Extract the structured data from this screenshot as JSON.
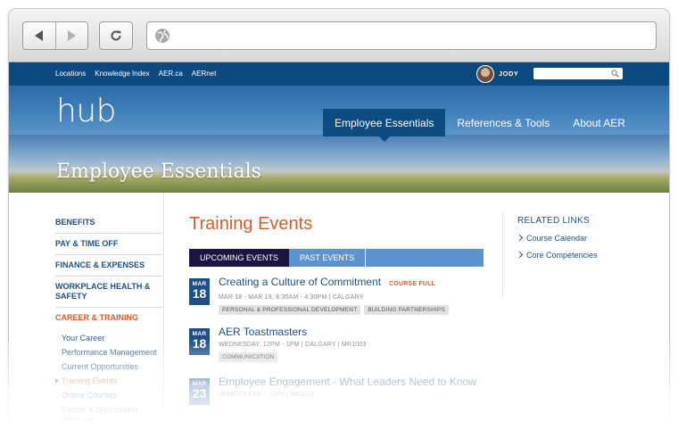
{
  "topbar": {
    "links": [
      "Locations",
      "Knowledge Index",
      "AER.ca",
      "AERnet"
    ],
    "username": "JODY",
    "search_placeholder": ""
  },
  "hero": {
    "logo": "hub",
    "nav": [
      "Employee Essentials",
      "References & Tools",
      "About AER"
    ],
    "active_nav": "Employee Essentials",
    "title": "Employee Essentials"
  },
  "sidebar": {
    "items": [
      "BENEFITS",
      "PAY & TIME OFF",
      "FINANCE & EXPENSES",
      "WORKPLACE HEALTH & SAFETY",
      "CAREER & TRAINING"
    ],
    "subitems": [
      "Your Career",
      "Performance Management",
      "Current Opportunities",
      "Training Events",
      "Online Courses",
      "Career & Succession Planning"
    ]
  },
  "main": {
    "title": "Training Events",
    "tabs": [
      "UPCOMING EVENTS",
      "PAST EVENTS"
    ],
    "events": [
      {
        "month": "MAR",
        "day": "18",
        "title": "Creating a Culture of Commitment",
        "badge": "COURSE FULL",
        "meta": "MAR 18 - MAR 19, 8:30AM - 4:30PM | CALGARY",
        "tags": [
          "PERSONAL & PROFESSIONAL DEVELOPMENT",
          "BUILDING PARTNERSHIPS"
        ]
      },
      {
        "month": "MAR",
        "day": "18",
        "title": "AER Toastmasters",
        "meta": "WEDNESDAY, 12PM - 1PM | CALGARY | MR1003",
        "tags": [
          "COMMUNICATION"
        ]
      },
      {
        "month": "MAR",
        "day": "23",
        "title": "Employee Engagement - What Leaders Need to Know",
        "meta": "MONDAY 9AM - 12PM | MR1011",
        "tags": []
      }
    ]
  },
  "related": {
    "heading": "RELATED LINKS",
    "links": [
      "Course Calendar",
      "Core Competencies"
    ]
  },
  "colors": {
    "brand_blue": "#0b4a80",
    "link_blue": "#1e4f86",
    "accent_orange": "#d95d2a"
  }
}
